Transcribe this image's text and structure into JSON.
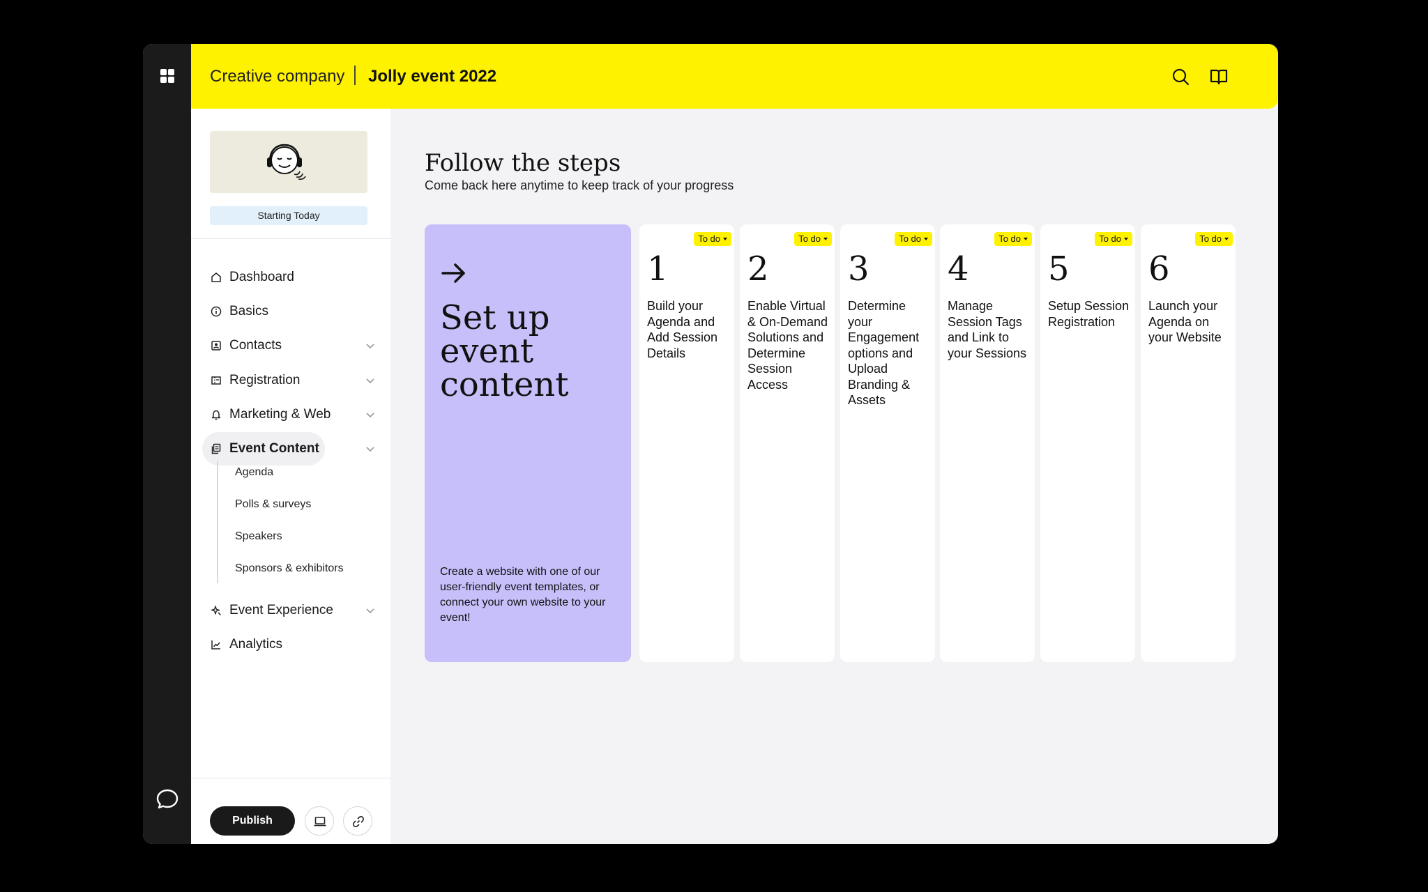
{
  "header": {
    "company": "Creative company",
    "event": "Jolly event 2022",
    "icons": [
      "apps-grid-icon",
      "search-icon",
      "book-icon",
      "chat-icon"
    ]
  },
  "sidebar": {
    "banner_status": "Starting Today",
    "items": [
      {
        "label": "Dashboard",
        "icon": "home-icon",
        "expandable": false
      },
      {
        "label": "Basics",
        "icon": "info-icon",
        "expandable": false
      },
      {
        "label": "Contacts",
        "icon": "contact-card-icon",
        "expandable": true
      },
      {
        "label": "Registration",
        "icon": "ticket-icon",
        "expandable": true
      },
      {
        "label": "Marketing & Web",
        "icon": "bell-icon",
        "expandable": true
      },
      {
        "label": "Event Content",
        "icon": "pages-icon",
        "expandable": true,
        "active": true
      },
      {
        "label": "Event Experience",
        "icon": "sparkle-icon",
        "expandable": true
      },
      {
        "label": "Analytics",
        "icon": "line-chart-icon",
        "expandable": false
      }
    ],
    "subitems": [
      "Agenda",
      "Polls & surveys",
      "Speakers",
      "Sponsors & exhibitors"
    ],
    "publish_label": "Publish"
  },
  "main": {
    "title": "Follow the steps",
    "subtitle": "Come back here anytime to keep track of your progress",
    "hero": {
      "title": "Set up event content",
      "description": "Create a website with one of our user-friendly event templates, or connect your own website to your event!"
    },
    "steps": [
      {
        "number": "1",
        "status": "To do",
        "label": "Build your Agenda and Add Session Details"
      },
      {
        "number": "2",
        "status": "To do",
        "label": "Enable Virtual & On-Demand Solutions and Determine Session Access"
      },
      {
        "number": "3",
        "status": "To do",
        "label": "Determine your Engagement options and Upload Branding & Assets"
      },
      {
        "number": "4",
        "status": "To do",
        "label": "Manage Session Tags and Link to your Sessions"
      },
      {
        "number": "5",
        "status": "To do",
        "label": "Setup Session Registration"
      },
      {
        "number": "6",
        "status": "To do",
        "label": "Launch your Agenda on your Website"
      }
    ]
  },
  "colors": {
    "accent_yellow": "#fff200",
    "hero_purple": "#c7bffa",
    "rail_dark": "#1b1b1b",
    "banner_bg": "#ecebde",
    "status_bg": "#e2f0fb"
  }
}
